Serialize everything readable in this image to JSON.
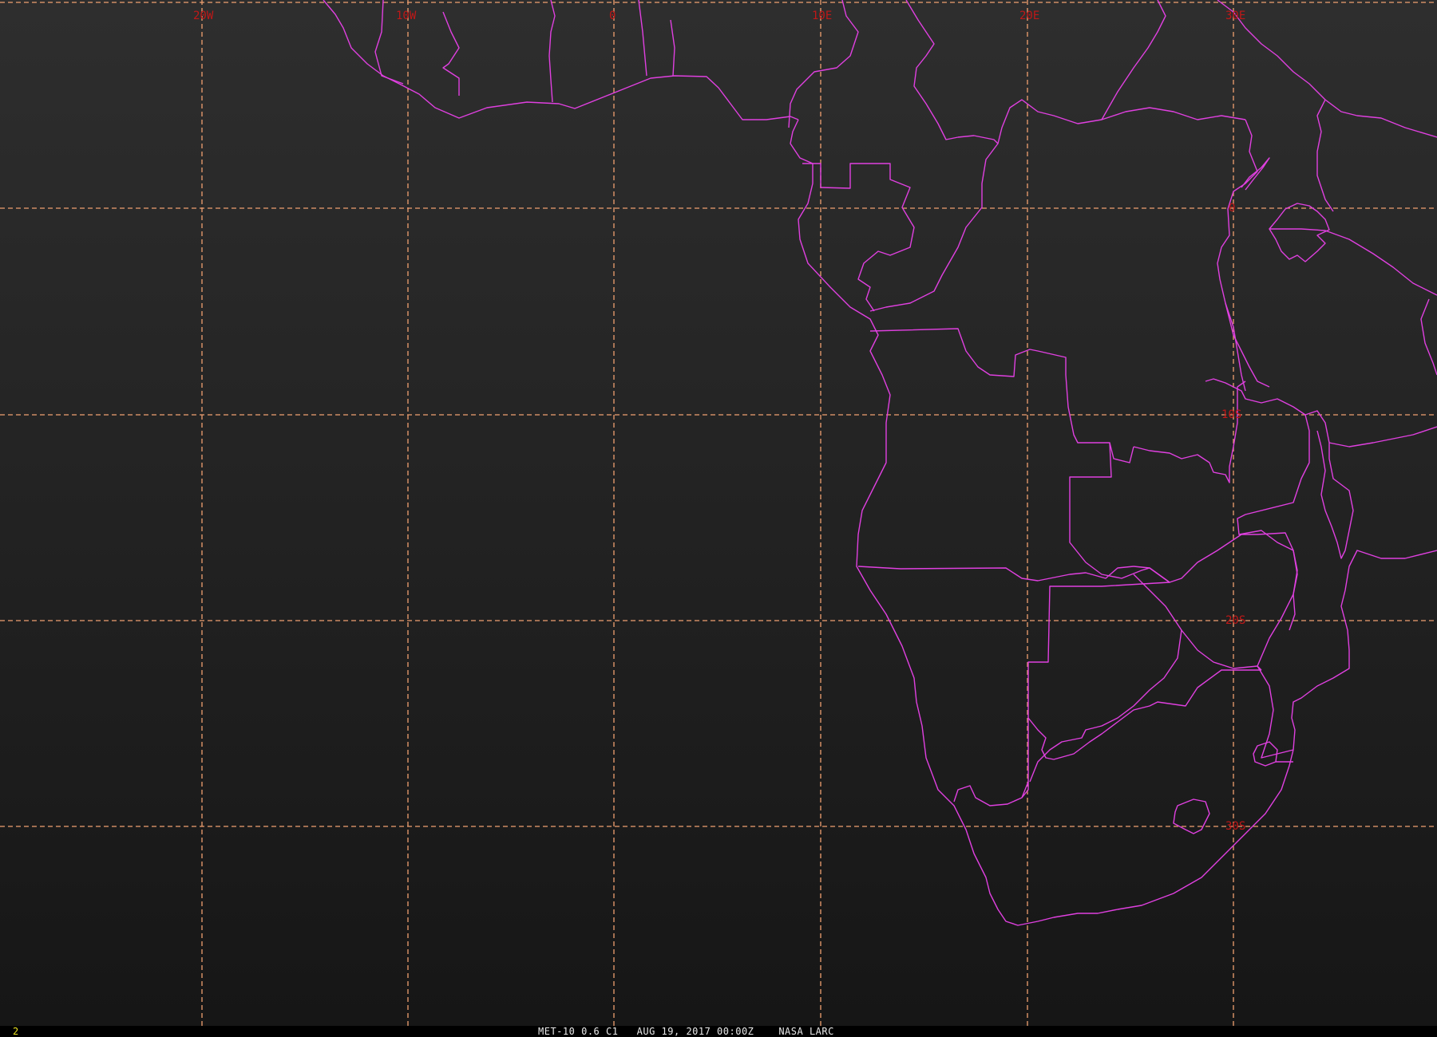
{
  "viewer": {
    "frame_number": "2",
    "caption": {
      "satellite": "MET-10",
      "channel": "0.6 C1",
      "datetime": "AUG 19, 2017 00:00Z",
      "agency": "NASA LARC"
    }
  },
  "map": {
    "longitude_labels": [
      "20W",
      "10W",
      "0",
      "10E",
      "20E",
      "30E"
    ],
    "latitude_labels": [
      "0",
      "10S",
      "20S",
      "30S"
    ],
    "colors": {
      "background": "#1e1e1e",
      "grid": "#f0a070",
      "borders": "#e040e0",
      "labels": "#c01818"
    }
  }
}
